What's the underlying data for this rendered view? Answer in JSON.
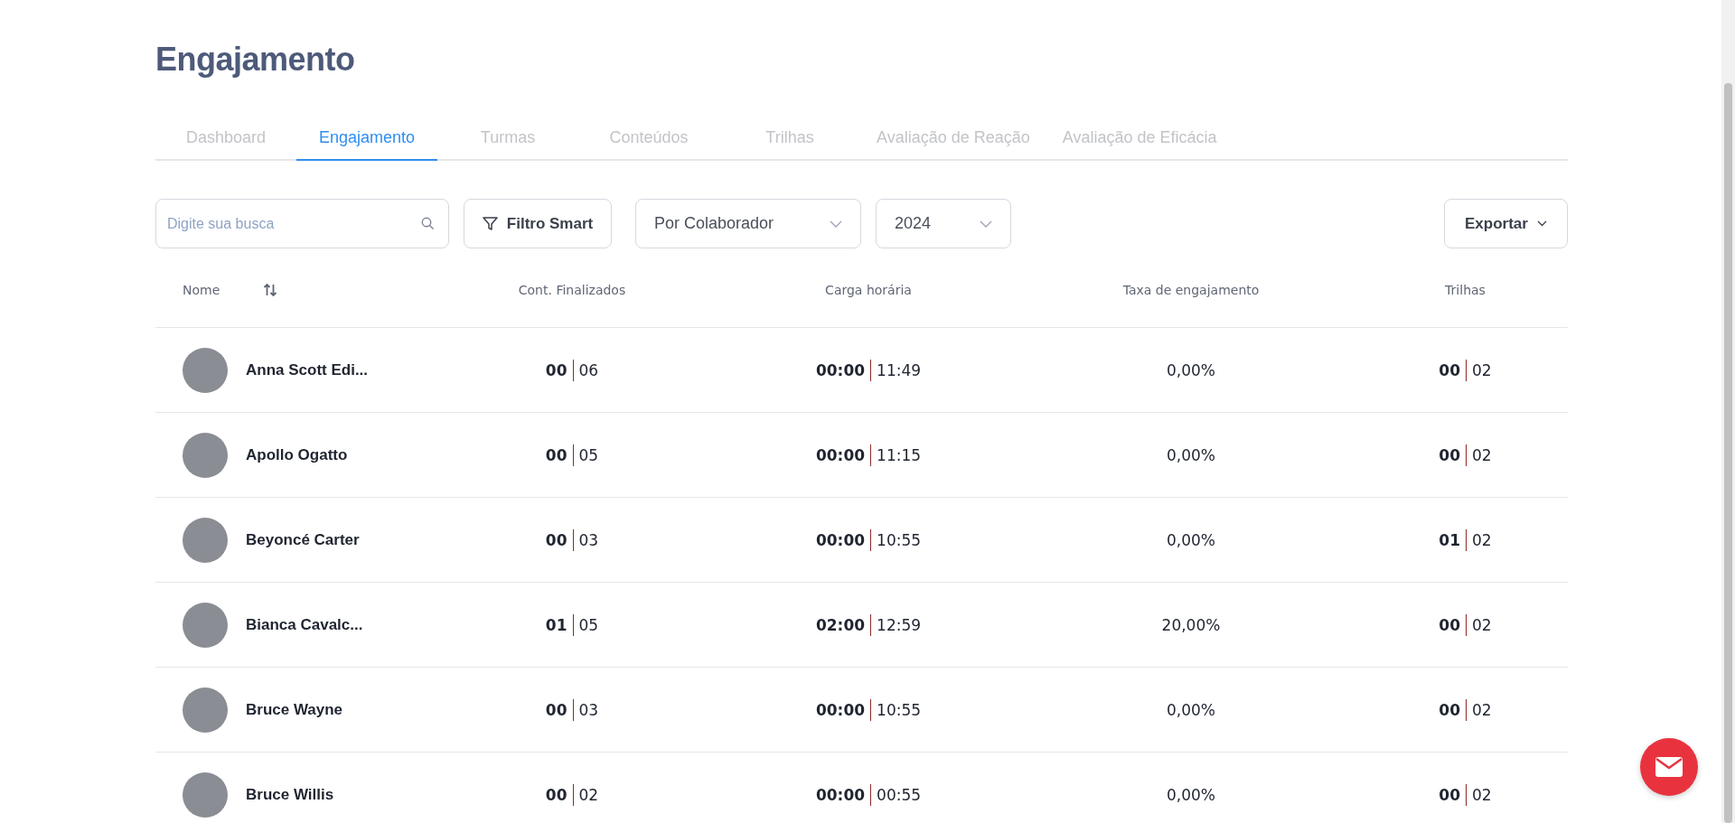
{
  "title": "Engajamento",
  "tabs": [
    {
      "label": "Dashboard",
      "selected": false
    },
    {
      "label": "Engajamento",
      "selected": true
    },
    {
      "label": "Turmas",
      "selected": false
    },
    {
      "label": "Conteúdos",
      "selected": false
    },
    {
      "label": "Trilhas",
      "selected": false
    },
    {
      "label": "Avaliação de Reação",
      "selected": false
    },
    {
      "label": "Avaliação de Eficácia",
      "selected": false
    }
  ],
  "search": {
    "placeholder": "Digite sua busca"
  },
  "filter_button": "Filtro Smart",
  "group_select": "Por Colaborador",
  "year_select": "2024",
  "export_button": "Exportar",
  "table": {
    "columns": [
      "Nome",
      "Cont. Finalizados",
      "Carga horária",
      "Taxa de engajamento",
      "Trilhas"
    ],
    "rows": [
      {
        "name": "Anna Scott Edi...",
        "contents": [
          "00",
          "06"
        ],
        "hours": [
          "00:00",
          "11:49"
        ],
        "rate": "0,00%",
        "tracks": [
          "00",
          "02"
        ]
      },
      {
        "name": "Apollo Ogatto",
        "contents": [
          "00",
          "05"
        ],
        "hours": [
          "00:00",
          "11:15"
        ],
        "rate": "0,00%",
        "tracks": [
          "00",
          "02"
        ]
      },
      {
        "name": "Beyoncé Carter",
        "contents": [
          "00",
          "03"
        ],
        "hours": [
          "00:00",
          "10:55"
        ],
        "rate": "0,00%",
        "tracks": [
          "01",
          "02"
        ]
      },
      {
        "name": "Bianca Cavalc...",
        "contents": [
          "01",
          "05"
        ],
        "hours": [
          "02:00",
          "12:59"
        ],
        "rate": "20,00%",
        "tracks": [
          "00",
          "02"
        ]
      },
      {
        "name": "Bruce Wayne",
        "contents": [
          "00",
          "03"
        ],
        "hours": [
          "00:00",
          "10:55"
        ],
        "rate": "0,00%",
        "tracks": [
          "00",
          "02"
        ]
      },
      {
        "name": "Bruce Willis",
        "contents": [
          "00",
          "02"
        ],
        "hours": [
          "00:00",
          "00:55"
        ],
        "rate": "0,00%",
        "tracks": [
          "00",
          "02"
        ]
      }
    ]
  }
}
